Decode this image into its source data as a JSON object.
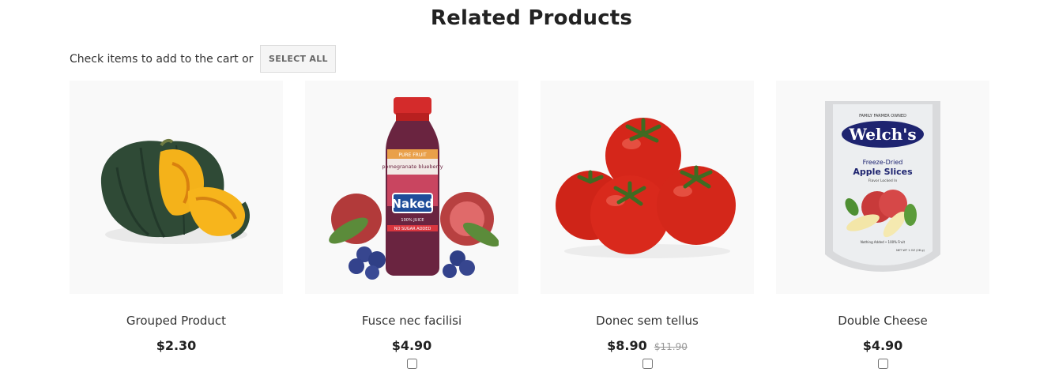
{
  "section": {
    "title": "Related Products",
    "intro_text": "Check items to add to the cart or",
    "select_all_label": "SELECT ALL"
  },
  "products": [
    {
      "name": "Grouped Product",
      "price": "$2.30",
      "old_price": "",
      "has_checkbox": false,
      "image": "pumpkin-image"
    },
    {
      "name": "Fusce nec facilisi",
      "price": "$4.90",
      "old_price": "",
      "has_checkbox": true,
      "image": "juice-bottle-image",
      "image_text": {
        "flavor_top": "PURE FRUIT",
        "flavor": "pomegranate blueberry",
        "brand": "Naked",
        "juice": "100% JUICE",
        "no_sugar": "NO SUGAR ADDED"
      }
    },
    {
      "name": "Donec sem tellus",
      "price": "$8.90",
      "old_price": "$11.90",
      "has_checkbox": true,
      "image": "tomatoes-image"
    },
    {
      "name": "Double Cheese",
      "price": "$4.90",
      "old_price": "",
      "has_checkbox": true,
      "image": "apple-slices-bag-image",
      "image_text": {
        "tagline": "FAMILY FARMER OWNED",
        "brand": "Welch's",
        "line1": "Freeze-Dried",
        "line2": "Apple Slices",
        "line3": "Flavor Locked In",
        "footer": "Nothing Added • 100% Fruit",
        "weight": "NET WT 1 OZ (28 g)"
      }
    }
  ]
}
